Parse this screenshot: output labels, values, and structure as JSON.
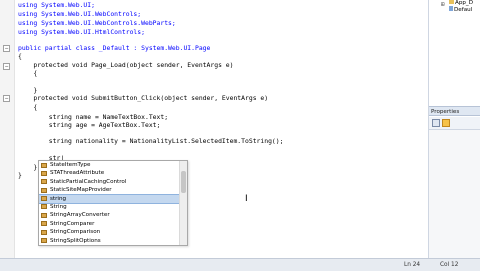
{
  "code": {
    "lines": [
      "using System.Web.UI;",
      "using System.Web.UI.WebControls;",
      "using System.Web.UI.WebControls.WebParts;",
      "using System.Web.UI.HtmlControls;",
      "",
      "public partial class _Default : System.Web.UI.Page",
      "{",
      "    protected void Page_Load(object sender, EventArgs e)",
      "    {",
      "",
      "    }",
      "    protected void SubmitButton_Click(object sender, EventArgs e)",
      "    {",
      "        string name = NameTextBox.Text;",
      "        string age = AgeTextBox.Text;",
      "",
      "        string nationality = NationalityList.SelectedItem.ToString();",
      "",
      "        str|",
      "    }",
      "}"
    ]
  },
  "intellisense": {
    "items": [
      "StateItemType",
      "STAThreadAttribute",
      "StaticPartialCachingControl",
      "StaticSiteMapProvider",
      "string",
      "String",
      "StringArrayConverter",
      "StringComparer",
      "StringComparison",
      "StringSplitOptions"
    ],
    "selected_index": 4
  },
  "right_panel": {
    "tree": [
      "App_D",
      "Defaul"
    ],
    "properties_title": "Properties"
  },
  "statusbar": {
    "line": "Ln 24",
    "col": "Col 12"
  }
}
